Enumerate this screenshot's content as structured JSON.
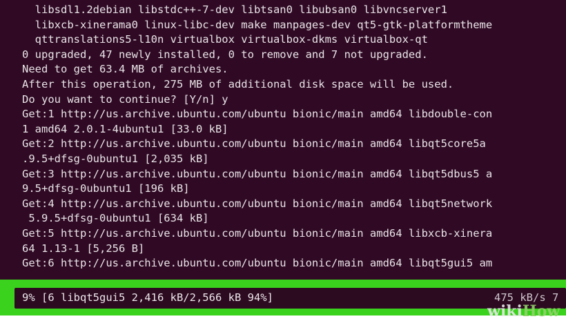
{
  "terminal": {
    "lines": [
      "  libsdl1.2debian libstdc++-7-dev libtsan0 libubsan0 libvncserver1",
      "  libxcb-xinerama0 linux-libc-dev make manpages-dev qt5-gtk-platformtheme",
      "  qttranslations5-l10n virtualbox virtualbox-dkms virtualbox-qt",
      "0 upgraded, 47 newly installed, 0 to remove and 7 not upgraded.",
      "Need to get 63.4 MB of archives.",
      "After this operation, 275 MB of additional disk space will be used.",
      "Do you want to continue? [Y/n] y",
      "Get:1 http://us.archive.ubuntu.com/ubuntu bionic/main amd64 libdouble-con",
      "1 amd64 2.0.1-4ubuntu1 [33.0 kB]",
      "Get:2 http://us.archive.ubuntu.com/ubuntu bionic/main amd64 libqt5core5a",
      ".9.5+dfsg-0ubuntu1 [2,035 kB]",
      "Get:3 http://us.archive.ubuntu.com/ubuntu bionic/main amd64 libqt5dbus5 a",
      "9.5+dfsg-0ubuntu1 [196 kB]",
      "Get:4 http://us.archive.ubuntu.com/ubuntu bionic/main amd64 libqt5network",
      " 5.9.5+dfsg-0ubuntu1 [634 kB]",
      "Get:5 http://us.archive.ubuntu.com/ubuntu bionic/main amd64 libxcb-xinera",
      "64 1.13-1 [5,256 B]",
      "Get:6 http://us.archive.ubuntu.com/ubuntu bionic/main amd64 libqt5gui5 am"
    ],
    "progress_line": "9% [6 libqt5gui5 2,416 kB/2,566 kB 94%]",
    "speed": "475 kB/s 7",
    "colors": {
      "background": "#300a24",
      "text": "#e9e4e8",
      "highlight": "#3ad21c"
    }
  },
  "watermark": {
    "part1": "wiki",
    "part2": "How"
  }
}
